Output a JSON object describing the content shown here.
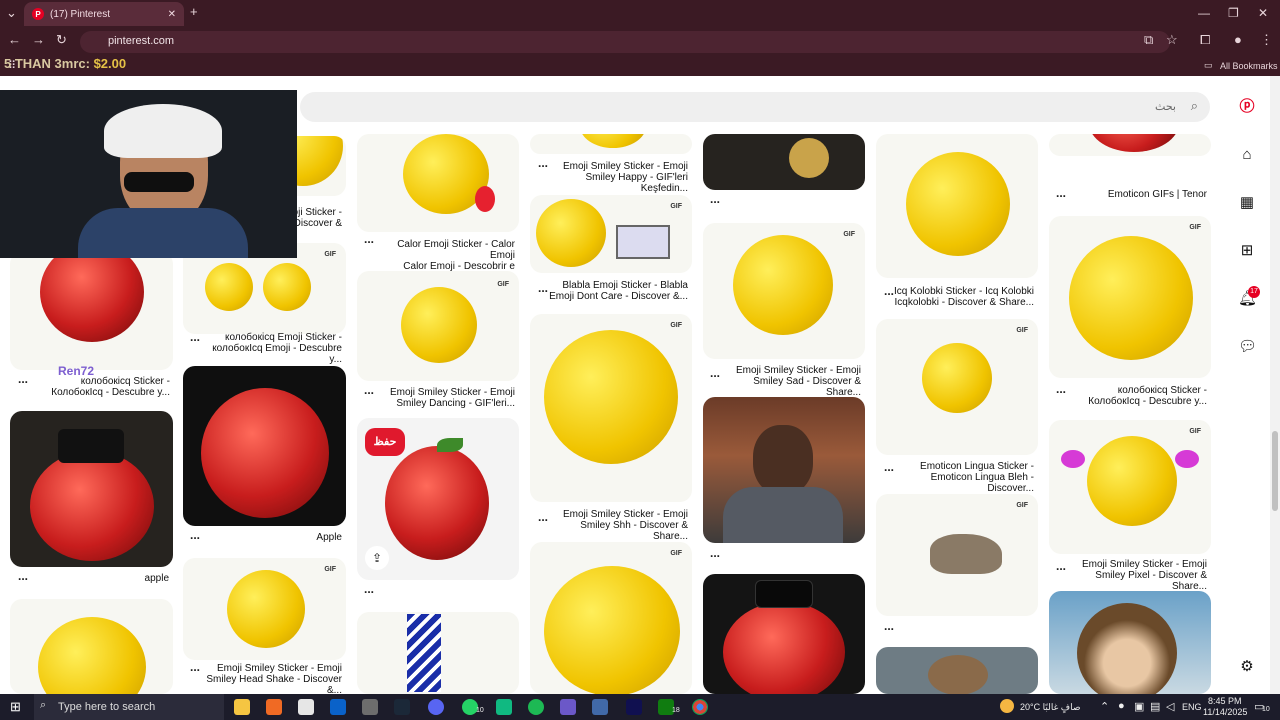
{
  "browser": {
    "tab_title": "(17) Pinterest",
    "url": "pinterest.com",
    "all_bookmarks": "All Bookmarks",
    "overlay_text": "5 THAN 3mrc: ",
    "overlay_price": "$2.00"
  },
  "search": {
    "placeholder": "بحث"
  },
  "sidebar": {
    "notif_badge": "17"
  },
  "stream": {
    "username": "Ren72"
  },
  "pins": {
    "c1": [
      {
        "caption": "колобокicq Sticker -\nКолобокIcq - Descubre y...",
        "dots": "..."
      },
      {
        "caption": "apple",
        "dots": "..."
      }
    ],
    "c2": [
      {
        "caption": "Emoji Sticker -\n- Discover &",
        "dots": ""
      },
      {
        "caption": "колобокicq Emoji Sticker -\nколобокIcq Emoji - Descubre y...",
        "dots": "...",
        "gif": "GIF"
      },
      {
        "caption": "Apple",
        "dots": "..."
      },
      {
        "caption": "Emoji Smiley Sticker - Emoji\nSmiley Head Shake - Discover &...",
        "dots": "...",
        "gif": "GIF"
      }
    ],
    "c3": [
      {
        "caption": "Calor Emoji Sticker - Calor Emoji\nCalor Emoji - Descobrir e Compartilhar...",
        "dots": "..."
      },
      {
        "caption": "Emoji Smiley Sticker - Emoji\nSmiley Dancing - GIF'leri...",
        "dots": "...",
        "gif": "GIF"
      },
      {
        "caption": "",
        "dots": "...",
        "save": "حفظ"
      }
    ],
    "c4": [
      {
        "caption": "Emoji Smiley Sticker - Emoji\nSmiley Happy - GIF'leri Keşfedin...",
        "dots": "..."
      },
      {
        "caption": "Blabla Emoji Sticker - Blabla\nEmoji Dont Care - Discover &...",
        "dots": "...",
        "gif": "GIF"
      },
      {
        "caption": "Emoji Smiley Sticker - Emoji\nSmiley Shh - Discover & Share...",
        "dots": "...",
        "gif": "GIF"
      },
      {
        "caption": "",
        "dots": "",
        "gif": "GIF"
      }
    ],
    "c5": [
      {
        "caption": "",
        "dots": "..."
      },
      {
        "caption": "Emoji Smiley Sticker - Emoji\nSmiley Sad - Discover & Share...",
        "dots": "...",
        "gif": "GIF"
      },
      {
        "caption": "",
        "dots": "..."
      }
    ],
    "c6": [
      {
        "caption": "Icq Kolobki Sticker - Icq Kolobki\nIcqkolobki - Discover & Share...",
        "dots": "..."
      },
      {
        "caption": "Emoticon Lingua Sticker -\nEmoticon Lingua Bleh - Discover...",
        "dots": "...",
        "gif": "GIF"
      },
      {
        "caption": "",
        "dots": "...",
        "gif": "GIF"
      }
    ],
    "c7": [
      {
        "caption": "Emoticon GIFs | Tenor",
        "dots": "..."
      },
      {
        "caption": "колобокicq Sticker -\nКолобокIcq - Descubre y...",
        "dots": "...",
        "gif": "GIF"
      },
      {
        "caption": "Emoji Smiley Sticker - Emoji\nSmiley Pixel - Discover & Share...",
        "dots": "...",
        "gif": "GIF"
      }
    ]
  },
  "taskbar": {
    "search_placeholder": "Type here to search",
    "weather": "20°C صافٍ غالبًا",
    "lang": "ENG",
    "time": "8:45 PM",
    "date": "11/14/2025",
    "badge_whatsapp": "10",
    "badge_xbox": "18",
    "badge_notif": "10"
  }
}
